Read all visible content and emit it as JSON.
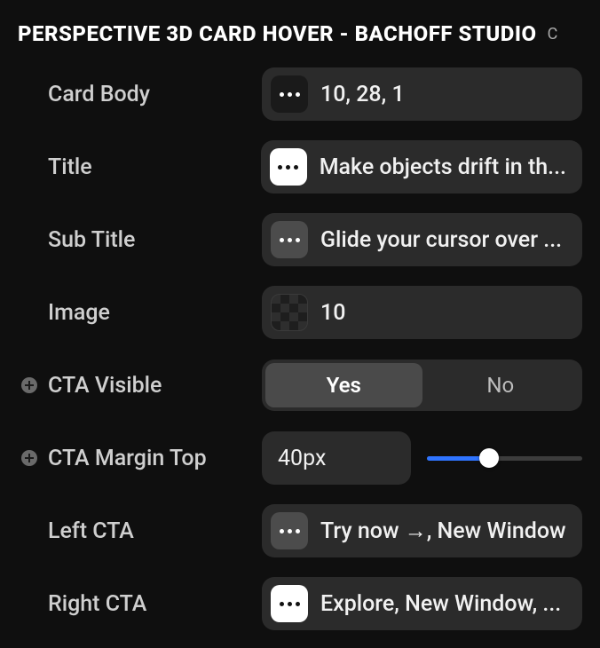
{
  "header": {
    "title": "PERSPECTIVE 3D CARD HOVER - BACHOFF STUDIO",
    "trailing": "C"
  },
  "rows": {
    "card_body": {
      "label": "Card Body",
      "chip": "dark",
      "value": "10, 28, 1"
    },
    "title": {
      "label": "Title",
      "chip": "light",
      "value": "Make objects drift in th..."
    },
    "sub_title": {
      "label": "Sub Title",
      "chip": "grey",
      "value": "Glide your cursor over ..."
    },
    "image": {
      "label": "Image",
      "chip": "checker",
      "value": "10"
    },
    "cta_visible": {
      "label": "CTA Visible",
      "options": {
        "yes": "Yes",
        "no": "No"
      },
      "selected": "yes"
    },
    "cta_margin_top": {
      "label": "CTA Margin Top",
      "value": "40px",
      "slider_percent": 40
    },
    "left_cta": {
      "label": "Left CTA",
      "chip": "grey",
      "value": "Try now →, New Window"
    },
    "right_cta": {
      "label": "Right CTA",
      "chip": "light",
      "value": "Explore, New Window, ..."
    }
  }
}
